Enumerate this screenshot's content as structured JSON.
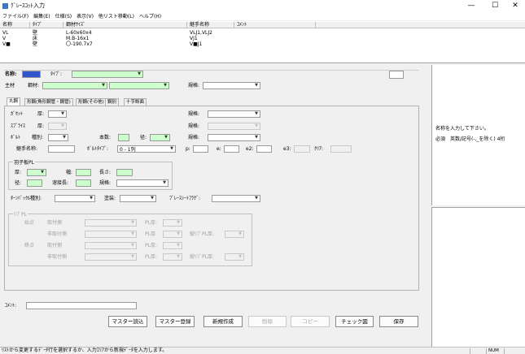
{
  "window": {
    "title": "ｸﾞﾚｰｽｺｯﾄ入力"
  },
  "menu": [
    "ファイル(F)",
    "編集(E)",
    "仕様(S)",
    "表示(V)",
    "他リスト移動(L)",
    "ヘルプ(H)"
  ],
  "list": {
    "headers": [
      "名称",
      "ﾀｲﾌﾟ",
      "鋼材ｻｲｽﾞ",
      "継手名称",
      "ｺﾒﾝﾄ"
    ],
    "rows": [
      [
        "VL",
        "壁",
        "L-60x60x4",
        "VLJ1,VLJ2",
        ""
      ],
      [
        "V",
        "床",
        "M.B-16x1",
        "VJ1",
        ""
      ],
      [
        "V■",
        "壁",
        "〇-190.7x7",
        "V■J1",
        ""
      ]
    ]
  },
  "form": {
    "name_label": "名称:",
    "type_label": "ﾀｲﾌﾟ:",
    "main_label": "主材",
    "steel_label": "鋼材:",
    "spec_label": "規格:",
    "tabs": [
      "丸鋼",
      "形鋼(角形鋼管・鋼管)",
      "形鋼(その他)",
      "鋼別",
      "十字断面"
    ],
    "gusset_label": "ｶﾞｾｯﾄ",
    "thick_label": "厚:",
    "spec2_label": "規格:",
    "splice_label": "ｽﾌﾟﾗｲｽ",
    "thick2_label": "厚:",
    "spec3_label": "規格:",
    "bolt_label": "ﾎﾞﾙﾄ",
    "kind_label": "種別:",
    "count_label": "本数:",
    "dia_label": "径:",
    "spec4_label": "規格:",
    "joint_label": "継手名称:",
    "bolt_type_label": "ﾎﾞﾙﾄﾀｲﾌﾟ:",
    "bolt_type_value": "0 - 1列",
    "p_label": "p:",
    "e_label": "e:",
    "e2_label": "e2:",
    "e3_label": "e3:",
    "clear_label": "ｸﾘｱ:",
    "fin_group": "羽子板PL",
    "fin_thick": "厚:",
    "fin_width": "幅:",
    "fin_length": "長さ:",
    "fin_dia": "径:",
    "fin_weld": "溶接長:",
    "fin_spec": "規格:",
    "turnbuckle_label": "ﾀｰﾝﾊﾞｯｸﾙ種別:",
    "paint_label": "塗装:",
    "brace_flag_label": "ﾌﾞﾚｰｽｼｰﾄﾌﾗｸﾞ:",
    "rib_group": "ﾘﾌﾞPL",
    "start_label": "始点",
    "end_label": "終点",
    "mount_label": "取付側",
    "nonmount_label": "非取付側",
    "pl_thick": "PL厚:",
    "rib_thick": "縦ﾘﾌﾞPL厚:",
    "comment_label": "ｺﾒﾝﾄ:"
  },
  "buttons": {
    "master_load": "マスター読込",
    "master_save": "マスター登録",
    "new": "新規作成",
    "delete": "削除",
    "copy": "コピー",
    "check": "チェック図",
    "save": "保存"
  },
  "help": {
    "line1": "名称を入力して下さい。",
    "line2": "必須　英数/記号(-,_を除く) 4桁"
  },
  "status": {
    "message": "ﾘｽﾄから変更するﾃﾞｰﾀ行を選択するか、入力ｴﾘｱから新規ﾃﾞｰﾀを入力します。",
    "num": "NUM"
  }
}
